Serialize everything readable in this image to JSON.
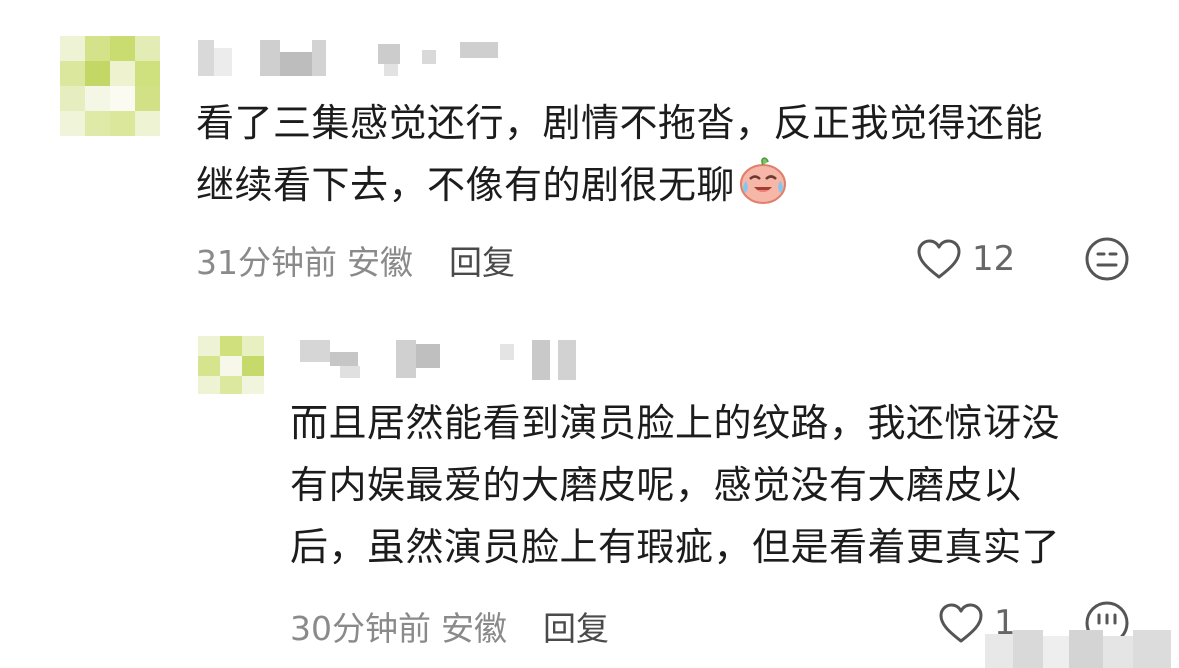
{
  "comments": [
    {
      "text_lines": [
        "看了三集感觉还行，剧情不拖沓，反正我觉得还能",
        "继续看下去，不像有的剧很无聊"
      ],
      "emoji": "crying-laughing-peach-emoji",
      "time": "31分钟前",
      "location": "安徽",
      "reply_label": "回复",
      "likes": "12",
      "icons": {
        "like": "heart-icon",
        "dislike": "meh-face-icon"
      }
    },
    {
      "text_lines": [
        "而且居然能看到演员脸上的纹路，我还惊讶没",
        "有内娱最爱的大磨皮呢，感觉没有大磨皮以",
        "后，虽然演员脸上有瑕疵，但是看着更真实了"
      ],
      "time": "30分钟前",
      "location": "安徽",
      "reply_label": "回复",
      "likes": "1",
      "icons": {
        "like": "heart-icon",
        "dislike": "meh-face-icon"
      }
    }
  ],
  "colors": {
    "text": "#1c1c1c",
    "meta": "#8a8a8a",
    "reply": "#4a4a4a",
    "icon": "#555555"
  }
}
